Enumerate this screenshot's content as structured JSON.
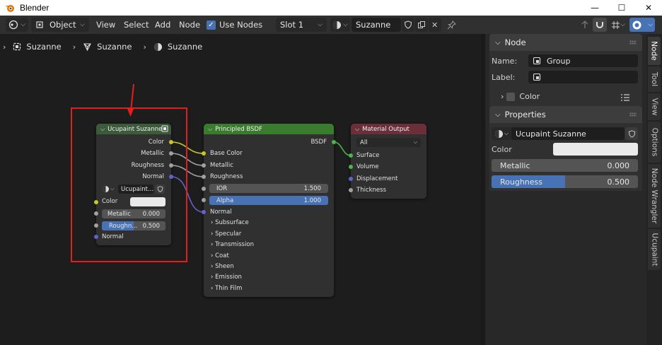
{
  "window": {
    "title": "Blender",
    "buttons": [
      "—",
      "☐",
      "✕"
    ]
  },
  "header": {
    "mode": "Object",
    "menus": [
      "View",
      "Select",
      "Add",
      "Node"
    ],
    "use_nodes_label": "Use Nodes",
    "use_nodes_checked": true,
    "slot": "Slot 1",
    "material": "Suzanne"
  },
  "breadcrumb": [
    "Suzanne",
    "Suzanne",
    "Suzanne"
  ],
  "group_node": {
    "title": "Ucupaint Suzanne",
    "outputs": [
      "Color",
      "Metallic",
      "Roughness",
      "Normal"
    ],
    "datablock": "Ucupaint...",
    "inputs": {
      "color_label": "Color",
      "metallic_label": "Metallic",
      "metallic_value": "0.000",
      "roughness_label": "Roughn...",
      "roughness_value": "0.500",
      "roughness_fraction": 0.5,
      "normal_label": "Normal"
    }
  },
  "bsdf_node": {
    "title": "Principled BSDF",
    "output": "BSDF",
    "inputs": [
      "Base Color",
      "Metallic",
      "Roughness"
    ],
    "ior_label": "IOR",
    "ior_value": "1.500",
    "alpha_label": "Alpha",
    "alpha_value": "1.000",
    "normal_label": "Normal",
    "panels": [
      "Subsurface",
      "Specular",
      "Transmission",
      "Coat",
      "Sheen",
      "Emission",
      "Thin Film"
    ]
  },
  "output_node": {
    "title": "Material Output",
    "target": "All",
    "inputs": [
      "Surface",
      "Volume",
      "Displacement",
      "Thickness"
    ]
  },
  "sidebar": {
    "node_panel": {
      "title": "Node",
      "name_label": "Name:",
      "name_value": "Group",
      "label_label": "Label:",
      "label_value": "",
      "color_label": "Color"
    },
    "properties_panel": {
      "title": "Properties",
      "datablock": "Ucupaint Suzanne",
      "color_label": "Color",
      "metallic_label": "Metallic",
      "metallic_value": "0.000",
      "roughness_label": "Roughness",
      "roughness_value": "0.500",
      "roughness_fraction": 0.5
    },
    "tabs": [
      "Node",
      "Tool",
      "View",
      "Options",
      "Node Wrangler",
      "Ucupaint"
    ],
    "active_tab": "Node"
  },
  "colors": {
    "annotation_red": "#e02020",
    "shader_header": "#3a7c2d",
    "output_header": "#6b2f3a",
    "group_header": "#3b5b3b",
    "accent_blue": "#4772b3"
  }
}
